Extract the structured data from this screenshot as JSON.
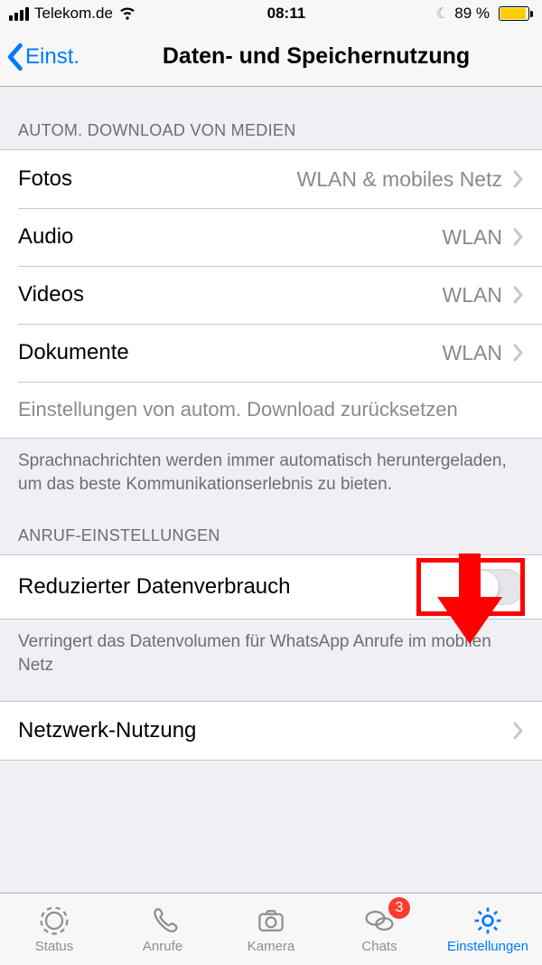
{
  "statusbar": {
    "carrier": "Telekom.de",
    "time": "08:11",
    "battery_percent": "89 %"
  },
  "nav": {
    "back_label": "Einst.",
    "title": "Daten- und Speichernutzung"
  },
  "sections": {
    "autodownload_header": "Autom. Download von Medien",
    "rows": {
      "photos": {
        "label": "Fotos",
        "value": "WLAN & mobiles Netz"
      },
      "audio": {
        "label": "Audio",
        "value": "WLAN"
      },
      "videos": {
        "label": "Videos",
        "value": "WLAN"
      },
      "documents": {
        "label": "Dokumente",
        "value": "WLAN"
      }
    },
    "reset_label": "Einstellungen von autom. Download zurücksetzen",
    "voice_footer": "Sprachnachrichten werden immer automatisch heruntergeladen, um das beste Kommunikationserlebnis zu bieten.",
    "call_header": "Anruf-Einstellungen",
    "low_data": {
      "label": "Reduzierter Datenverbrauch"
    },
    "low_data_footer": "Verringert das Datenvolumen für WhatsApp Anrufe im mobilen Netz",
    "network_usage": {
      "label": "Netzwerk-Nutzung"
    }
  },
  "tabs": {
    "status": "Status",
    "calls": "Anrufe",
    "camera": "Kamera",
    "chats": "Chats",
    "chats_badge": "3",
    "settings": "Einstellungen"
  }
}
